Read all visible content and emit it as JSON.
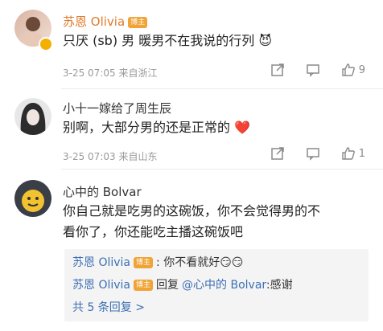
{
  "comments": [
    {
      "username": "苏恩 Olivia",
      "badge": "博主",
      "text": "只厌 (sb) 男 暖男不在我说的行列 😈",
      "time": "3-25 07:05 来自浙江",
      "likes": "9"
    },
    {
      "username": "小十一嫁给了周生辰",
      "text": "别啊，大部分男的还是正常的 ❤️",
      "time": "3-25 07:03 来自山东",
      "likes": "1"
    },
    {
      "username": "心中的 Bolvar",
      "text_line1": "你自己就是吃男的这碗饭，你不会觉得男的不",
      "text_line2": "看你了，你还能吃主播这碗饭吧"
    }
  ],
  "replies": [
    {
      "author": "苏恩 Olivia",
      "badge": "博主",
      "text": ": 你不看就好😏😏"
    },
    {
      "author": "苏恩 Olivia",
      "badge": "博主",
      "prefix": "回复",
      "mention": "@心中的 Bolvar",
      "text": ":感谢"
    }
  ],
  "more_replies": "共 5 条回复 >",
  "colors": {
    "accent_orange": "#e07a2a",
    "link_blue": "#3b6fb5",
    "badge": "#f0a336"
  }
}
